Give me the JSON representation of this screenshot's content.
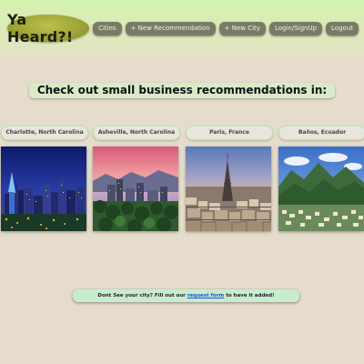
{
  "logo": {
    "text": "Ya Heard?!"
  },
  "nav": {
    "cities": "Cities",
    "new_recommendation": "+ New Recommendation",
    "new_city": "+ New City",
    "login": "Login/SignUp",
    "logout": "Logout"
  },
  "headline": "Check out small business recommendations in:",
  "cities": [
    {
      "label": "Charlotte, North Carolina",
      "image_icon": "city-skyline-night-photo"
    },
    {
      "label": "Asheville, North Carolina",
      "image_icon": "city-skyline-sunset-photo"
    },
    {
      "label": "Paris, France",
      "image_icon": "eiffel-tower-city-photo"
    },
    {
      "label": "Baños, Ecuador",
      "image_icon": "mountain-town-photo"
    }
  ],
  "footer": {
    "before": "Dont See your city? Fill out our",
    "link": "request form",
    "after": "to have it added!"
  },
  "colors": {
    "background": "#e5dccb",
    "header_top": "#d4f2b0",
    "nav_button": "#7a7b66",
    "logo": "#9ea136",
    "label_border": "#b4e8c0",
    "footer_bg": "#c9ecd1",
    "link": "#1a53d6"
  }
}
